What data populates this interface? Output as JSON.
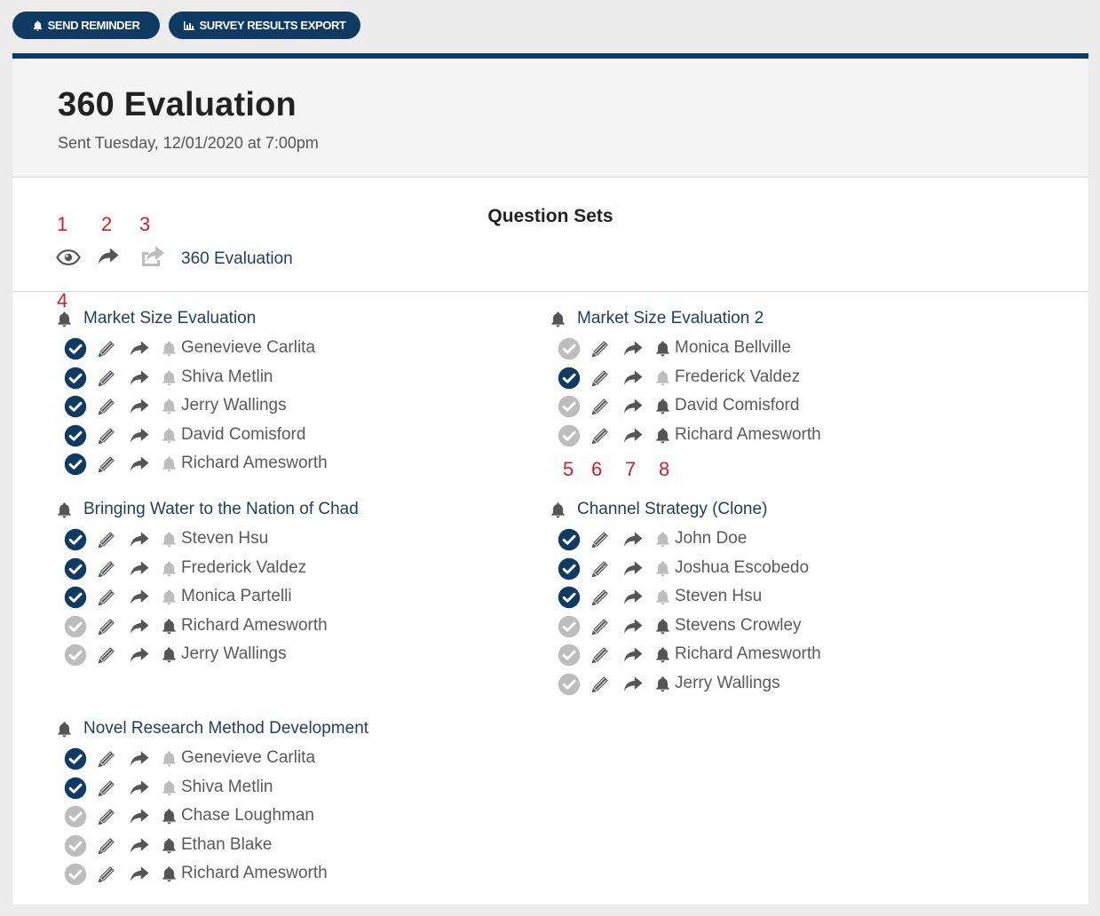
{
  "toolbar": {
    "send_reminder_label": "SEND REMINDER",
    "export_label": "SURVEY RESULTS EXPORT"
  },
  "header": {
    "title": "360 Evaluation",
    "sent": "Sent Tuesday, 12/01/2020 at 7:00pm"
  },
  "question_sets": {
    "heading": "Question Sets",
    "item_label": "360 Evaluation"
  },
  "annotations": [
    "1",
    "2",
    "3",
    "4",
    "5",
    "6",
    "7",
    "8"
  ],
  "colors": {
    "brand": "#0e3b63",
    "complete": "#0e3b63",
    "incomplete": "#bdbdbd",
    "icon_dark": "#555555",
    "icon_light": "#bdbdbd",
    "link": "#1b3f5f",
    "annotation": "#d21f26"
  },
  "groups": [
    {
      "title": "Market Size Evaluation",
      "people": [
        {
          "name": "Genevieve Carlita",
          "complete": true
        },
        {
          "name": "Shiva Metlin",
          "complete": true
        },
        {
          "name": "Jerry Wallings",
          "complete": true
        },
        {
          "name": "David Comisford",
          "complete": true
        },
        {
          "name": "Richard Amesworth",
          "complete": true
        }
      ]
    },
    {
      "title": "Market Size Evaluation 2",
      "people": [
        {
          "name": "Monica Bellville",
          "complete": false
        },
        {
          "name": "Frederick Valdez",
          "complete": true
        },
        {
          "name": "David Comisford",
          "complete": false
        },
        {
          "name": "Richard Amesworth",
          "complete": false
        }
      ]
    },
    {
      "title": "Bringing Water to the Nation of Chad",
      "people": [
        {
          "name": "Steven Hsu",
          "complete": true
        },
        {
          "name": "Frederick Valdez",
          "complete": true
        },
        {
          "name": "Monica Partelli",
          "complete": true
        },
        {
          "name": "Richard Amesworth",
          "complete": false
        },
        {
          "name": "Jerry Wallings",
          "complete": false
        }
      ]
    },
    {
      "title": "Channel Strategy (Clone)",
      "people": [
        {
          "name": "John Doe",
          "complete": true
        },
        {
          "name": "Joshua Escobedo",
          "complete": true
        },
        {
          "name": "Steven Hsu",
          "complete": true
        },
        {
          "name": "Stevens Crowley",
          "complete": false
        },
        {
          "name": "Richard Amesworth",
          "complete": false
        },
        {
          "name": "Jerry Wallings",
          "complete": false
        }
      ]
    },
    {
      "title": "Novel Research Method Development",
      "people": [
        {
          "name": "Genevieve Carlita",
          "complete": true
        },
        {
          "name": "Shiva Metlin",
          "complete": true
        },
        {
          "name": "Chase Loughman",
          "complete": false
        },
        {
          "name": "Ethan Blake",
          "complete": false
        },
        {
          "name": "Richard Amesworth",
          "complete": false
        }
      ]
    }
  ]
}
